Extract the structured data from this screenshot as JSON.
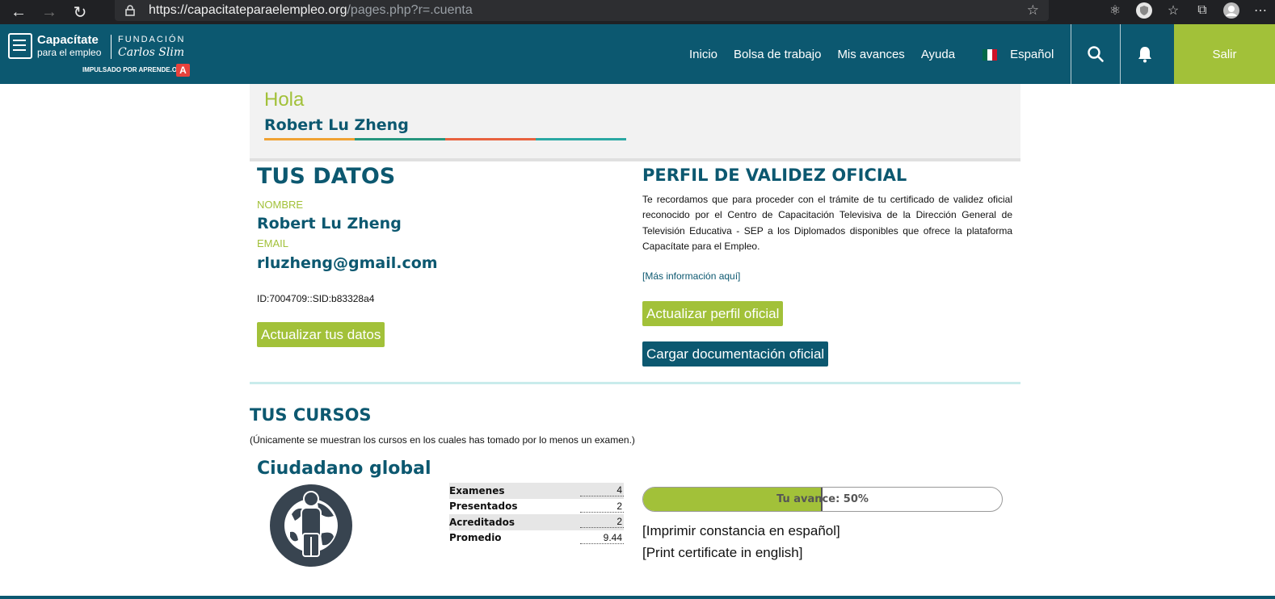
{
  "browser": {
    "url_host": "https://capacitateparaelempleo.org",
    "url_path": "/pages.php?r=.cuenta"
  },
  "header": {
    "logo": {
      "title": "Capacítate",
      "subtitle": "para el empleo",
      "fundacion": "FUNDACIÓN",
      "carlos": "Carlos Slim",
      "impulsado": "IMPULSADO POR APRENDE.ORG",
      "a_mark": "A"
    },
    "nav": [
      "Inicio",
      "Bolsa de trabajo",
      "Mis avances",
      "Ayuda"
    ],
    "language": "Español",
    "logout": "Salir"
  },
  "greeting": {
    "hello": "Hola",
    "name": "Robert Lu Zheng",
    "stripe_colors": [
      "#f0a233",
      "#26967e",
      "#e8623f",
      "#2aa8a3"
    ]
  },
  "datos": {
    "title": "TUS DATOS",
    "name_label": "NOMBRE",
    "name": "Robert Lu Zheng",
    "email_label": "EMAIL",
    "email": "rluzheng@gmail.com",
    "id_line": "ID:7004709::SID:b83328a4",
    "update_button": "Actualizar tus datos"
  },
  "perfil": {
    "title": "PERFIL DE VALIDEZ OFICIAL",
    "text": "Te recordamos que para proceder con el trámite de tu certificado de validez oficial reconocido por el Centro de Capacitación Televisiva de la Dirección General de Televisión Educativa - SEP a los Diplomados disponibles que ofrece la plataforma Capacítate para el Empleo.",
    "more_info": "[Más información aquí]",
    "update_button": "Actualizar perfil oficial",
    "upload_button": "Cargar documentación oficial"
  },
  "cursos": {
    "title": "TUS CURSOS",
    "note": "(Únicamente se muestran los cursos en los cuales has tomado por lo menos un examen.)",
    "course": {
      "name": "Ciudadano global",
      "stats": [
        {
          "label": "Examenes",
          "value": "4"
        },
        {
          "label": "Presentados",
          "value": "2"
        },
        {
          "label": "Acreditados",
          "value": "2"
        },
        {
          "label": "Promedio",
          "value": "9.44"
        }
      ],
      "progress_label": "Tu avance: 50%",
      "progress": 0.5,
      "print_es": "[Imprimir constancia en español]",
      "print_en": "[Print certificate in english]"
    }
  },
  "colors": {
    "primary": "#0c5870",
    "accent": "#a2c139"
  }
}
